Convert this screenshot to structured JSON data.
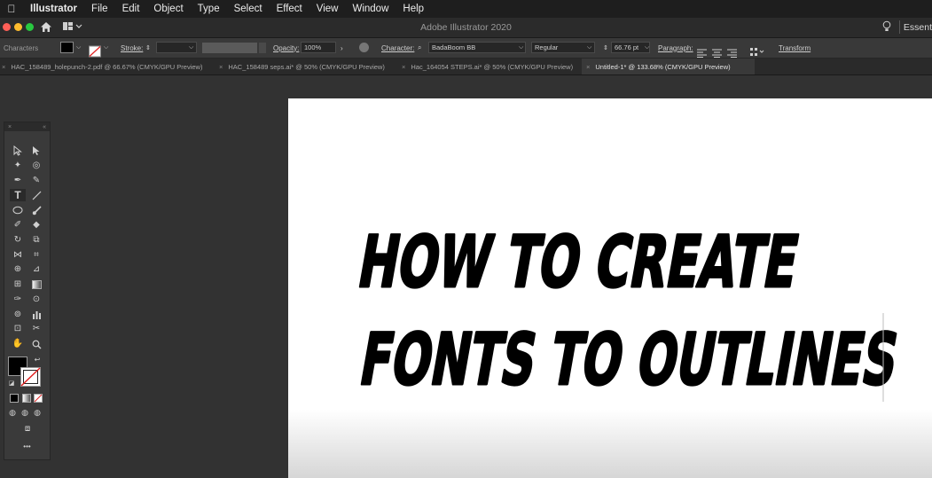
{
  "menubar": {
    "apple": "",
    "items": [
      "Illustrator",
      "File",
      "Edit",
      "Object",
      "Type",
      "Select",
      "Effect",
      "View",
      "Window",
      "Help"
    ]
  },
  "titlebar": {
    "title": "Adobe Illustrator 2020",
    "workspace": "Essent",
    "traffic_lights": [
      "#ff5f57",
      "#febc2e",
      "#28c840"
    ]
  },
  "control_bar": {
    "selection_label": "Characters",
    "stroke_label": "Stroke:",
    "opacity_label": "Opacity:",
    "opacity_value": "100%",
    "character_label": "Character:",
    "font_family": "BadaBoom BB",
    "font_style": "Regular",
    "font_size": "66.76 pt",
    "paragraph_label": "Paragraph:",
    "transform_label": "Transform"
  },
  "tabs": [
    {
      "label": "HAC_158489_holepunch-2.pdf @ 66.67% (CMYK/GPU Preview)",
      "active": false
    },
    {
      "label": "HAC_158489 seps.ai* @ 50% (CMYK/GPU Preview)",
      "active": false
    },
    {
      "label": "Hac_164054 STEPS.ai* @ 50% (CMYK/GPU Preview)",
      "active": false
    },
    {
      "label": "Untitled-1* @ 133.68% (CMYK/GPU Preview)",
      "active": true
    }
  ],
  "artboard": {
    "line1": "HOW TO CREATE",
    "line2": "FONTS TO OUTLINES"
  },
  "toolbar": {
    "more": "•••"
  },
  "colors": {
    "fill": "#000000",
    "accent_text": "#000000"
  }
}
